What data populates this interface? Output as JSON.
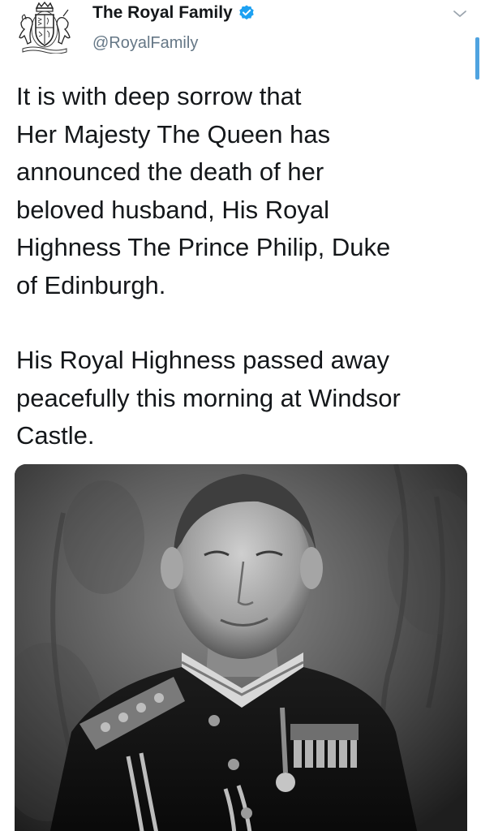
{
  "account": {
    "display_name": "The Royal Family",
    "handle": "@RoyalFamily",
    "verified": true,
    "avatar_icon": "royal-coat-of-arms-icon",
    "menu_icon": "chevron-down-icon"
  },
  "tweet": {
    "paragraphs": [
      "It is with deep sorrow that\nHer Majesty The Queen has\nannounced the death of her\nbeloved husband, His Royal\nHighness The Prince Philip, Duke\nof Edinburgh.",
      "His Royal Highness passed away\npeacefully this morning at Windsor\nCastle."
    ]
  },
  "media": {
    "type": "photo",
    "style": "black-and-white portrait"
  },
  "colors": {
    "text": "#14171a",
    "secondary": "#657786",
    "verified_badge": "#1da1f2",
    "scroll_indicator": "#4fa3e0"
  }
}
